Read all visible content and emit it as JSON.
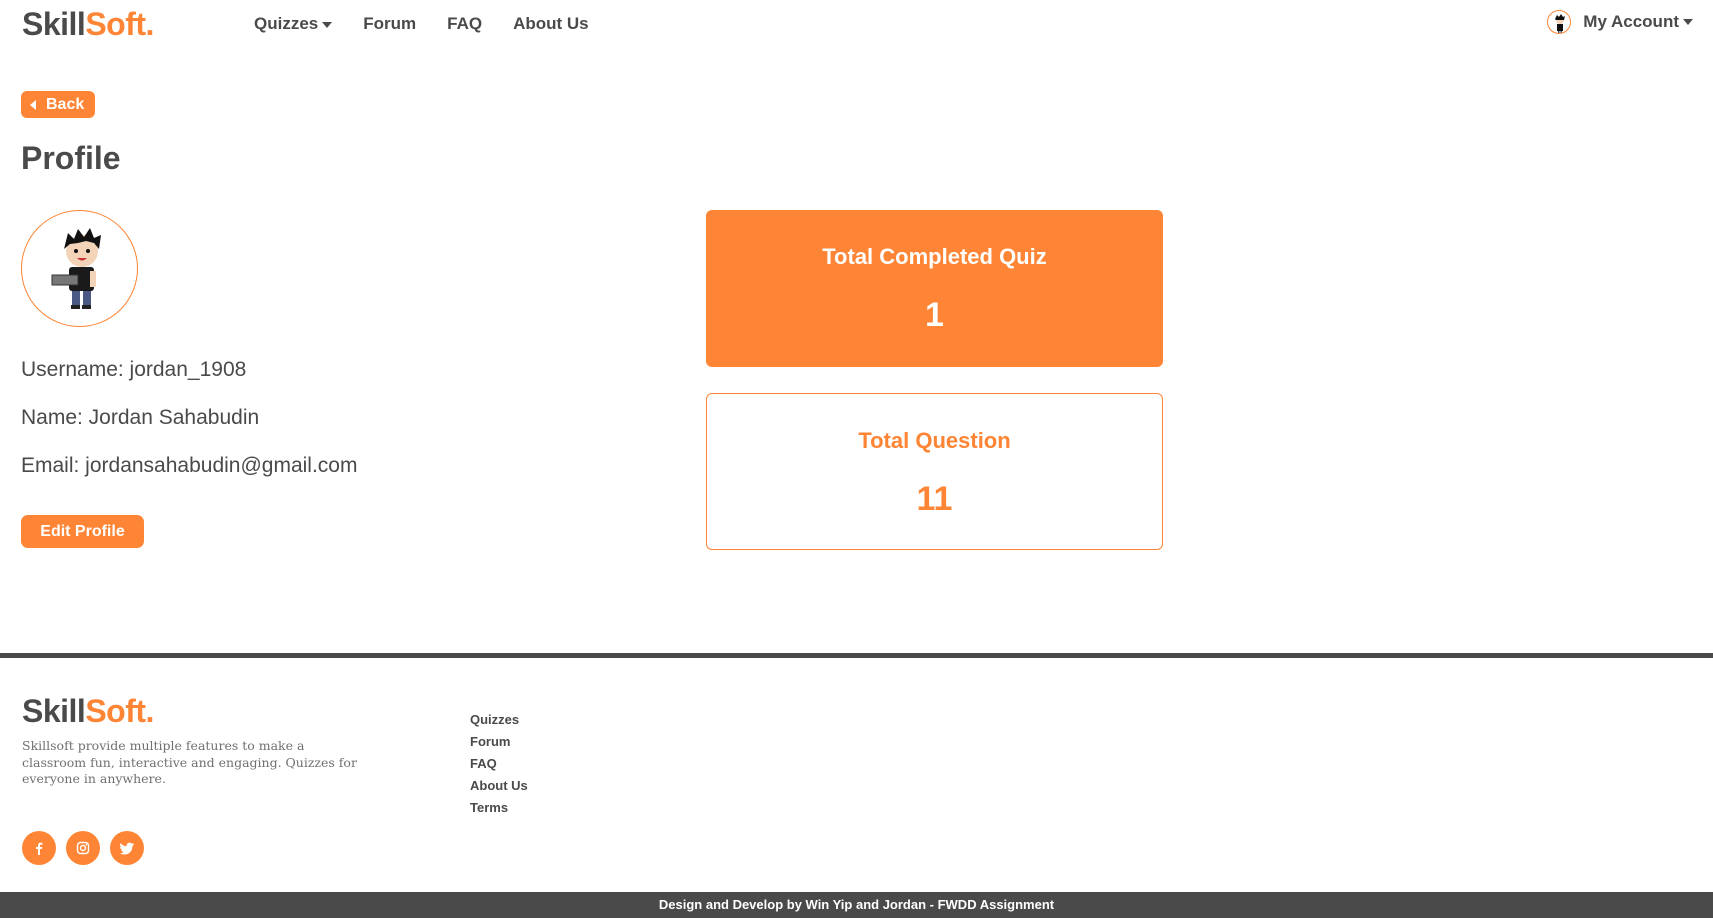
{
  "brand": {
    "part1": "Skill",
    "part2": "Soft."
  },
  "nav": {
    "quizzes": "Quizzes",
    "forum": "Forum",
    "faq": "FAQ",
    "about": "About Us"
  },
  "account": {
    "label": "My Account"
  },
  "back": {
    "label": "Back"
  },
  "profile": {
    "title": "Profile",
    "username": "Username: jordan_1908",
    "name": "Name: Jordan Sahabudin",
    "email": "Email: jordansahabudin@gmail.com",
    "edit_label": "Edit Profile"
  },
  "stats": {
    "completed_label": "Total Completed Quiz",
    "completed_value": "1",
    "questions_label": "Total Question",
    "questions_value": "11"
  },
  "footer": {
    "description": "Skillsoft provide multiple features to make a classroom fun, interactive and engaging. Quizzes for everyone in anywhere.",
    "links": [
      "Quizzes",
      "Forum",
      "FAQ",
      "About Us",
      "Terms"
    ],
    "socials": [
      "facebook-icon",
      "instagram-icon",
      "twitter-icon"
    ],
    "copyright": "Design and Develop by Win Yip and Jordan - FWDD Assignment"
  },
  "colors": {
    "accent": "#fd8535",
    "dark": "#4a4a4a"
  }
}
